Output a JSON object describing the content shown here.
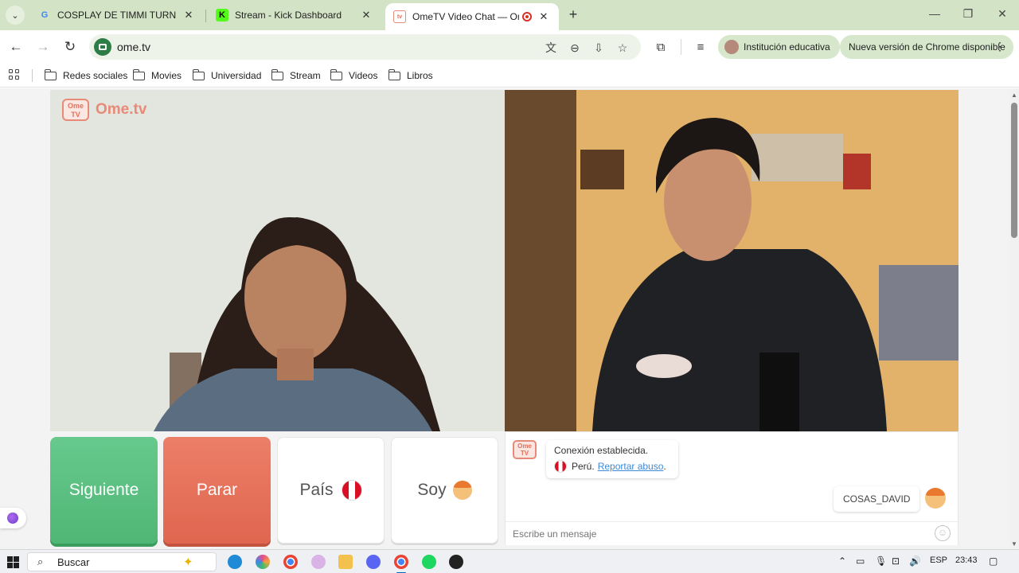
{
  "browser": {
    "tabs": [
      {
        "title": "COSPLAY DE TIMMI TURNER DE",
        "favicon": "google-icon"
      },
      {
        "title": "Stream - Kick Dashboard",
        "favicon": "kick-icon"
      },
      {
        "title": "OmeTV Video Chat — Ome",
        "favicon": "ometv-icon",
        "active": true
      }
    ],
    "new_tab": "+",
    "url": "ome.tv",
    "profile_label": "Institución educativa",
    "update_label": "Nueva versión de Chrome disponible",
    "bookmarks": [
      "Redes sociales",
      "Movies",
      "Universidad",
      "Stream",
      "Videos",
      "Libros"
    ]
  },
  "page": {
    "brand_badge": "Ome TV",
    "brand_name": "Ome.tv",
    "buttons": {
      "next": "Siguiente",
      "stop": "Parar",
      "country": "País",
      "gender": "Soy"
    },
    "chat": {
      "logo": "Ome TV",
      "status": "Conexión establecida.",
      "country": "Perú.",
      "report_link": "Reportar abuso",
      "report_suffix": ".",
      "username": "COSAS_DAVID",
      "input_placeholder": "Escribe un mensaje"
    }
  },
  "taskbar": {
    "search_label": "Buscar",
    "language": "ESP",
    "time": "23:43"
  },
  "colors": {
    "tab_strip": "#d3e3c5",
    "next_button": "#58bd7e",
    "stop_button": "#e6705a",
    "brand": "#e88a78",
    "link": "#3c8ad6"
  }
}
